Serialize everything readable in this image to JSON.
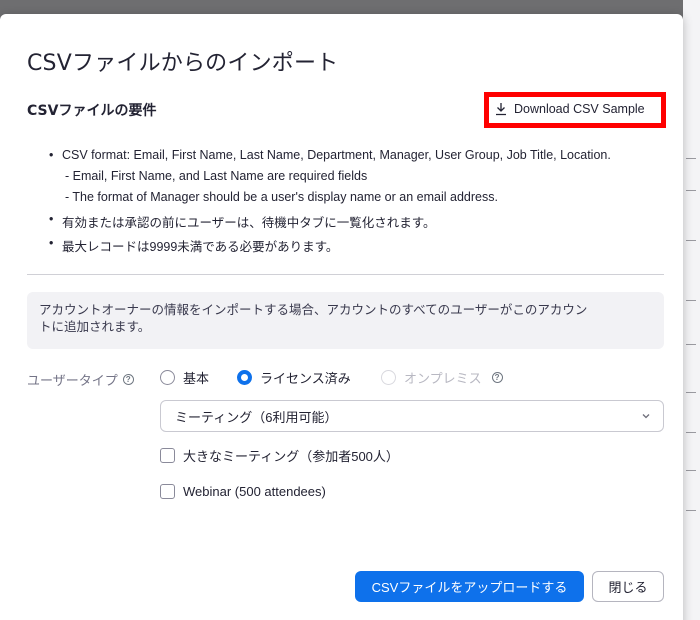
{
  "dialog": {
    "title": "CSVファイルからのインポート",
    "requirements_heading": "CSVファイルの要件",
    "download_label": "Download CSV Sample",
    "requirements": {
      "item1": "CSV format: Email, First Name, Last Name, Department, Manager, User Group, Job Title, Location.",
      "item1_sub1": "- Email, First Name, and Last Name are required fields",
      "item1_sub2": "- The format of Manager should be a user's display name or an email address.",
      "item2": "有効または承認の前にユーザーは、待機中タブに一覧化されます。",
      "item3": "最大レコードは9999未満である必要があります。"
    },
    "notice_line1": "アカウントオーナーの情報をインポートする場合、アカウントのすべてのユーザーがこのアカウン",
    "notice_line2": "トに追加されます。",
    "user_type_label": "ユーザータイプ",
    "radio_basic": "基本",
    "radio_licensed": "ライセンス済み",
    "radio_onprem": "オンプレミス",
    "selected_user_type": "ライセンス済み",
    "meeting_select_value": "ミーティング（6利用可能）",
    "large_meeting_label": "大きなミーティング（参加者500人）",
    "webinar_label": "Webinar (500 attendees)",
    "upload_button": "CSVファイルをアップロードする",
    "close_button": "閉じる"
  },
  "colors": {
    "primary": "#0e71eb",
    "highlight_border": "#ff0000",
    "notice_bg": "#f2f2f5"
  }
}
